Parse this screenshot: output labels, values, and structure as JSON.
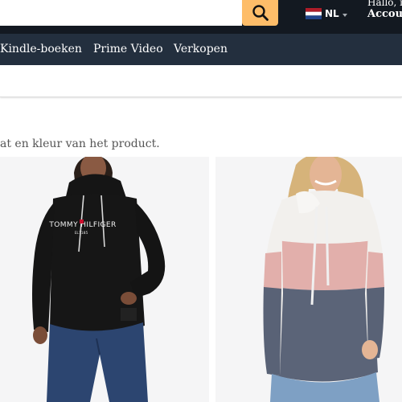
{
  "header": {
    "search_placeholder": "",
    "search_icon": "search-icon",
    "language_code": "NL",
    "language_flag": "flag-netherlands-icon",
    "account_greeting": "Hallo, in",
    "account_title": "Accoun"
  },
  "nav": {
    "items": [
      {
        "label": "Kindle-boeken"
      },
      {
        "label": "Prime Video"
      },
      {
        "label": "Verkopen"
      }
    ]
  },
  "main": {
    "subtitle": "at en kleur van het product."
  },
  "products": [
    {
      "image": "black-tommy-hilfiger-hoodie-photo",
      "print": "TOMMY HILFIGER"
    },
    {
      "image": "colorblock-pink-grey-hoodie-photo"
    }
  ],
  "colors": {
    "topbar": "#131921",
    "navbar": "#232f3e",
    "search_button": "#febd69",
    "card_bg": "#f5f5f6"
  }
}
